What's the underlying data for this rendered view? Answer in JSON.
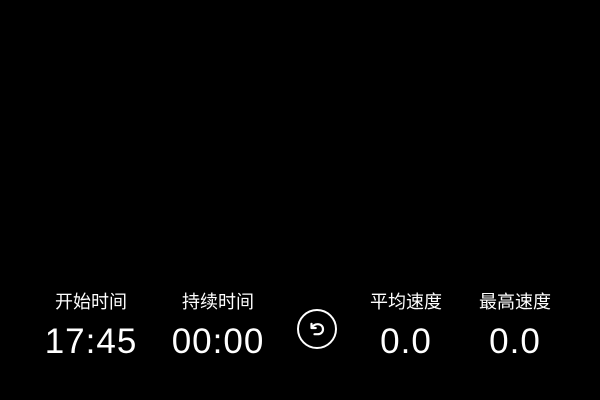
{
  "colors": {
    "background": "#000000",
    "text": "#ffffff"
  },
  "stats": {
    "start_time": {
      "label": "开始时间",
      "value": "17:45"
    },
    "duration": {
      "label": "持续时间",
      "value": "00:00"
    },
    "avg_speed": {
      "label": "平均速度",
      "value": "0.0"
    },
    "max_speed": {
      "label": "最高速度",
      "value": "0.0"
    }
  },
  "reset_button": {
    "icon": "undo-icon"
  }
}
